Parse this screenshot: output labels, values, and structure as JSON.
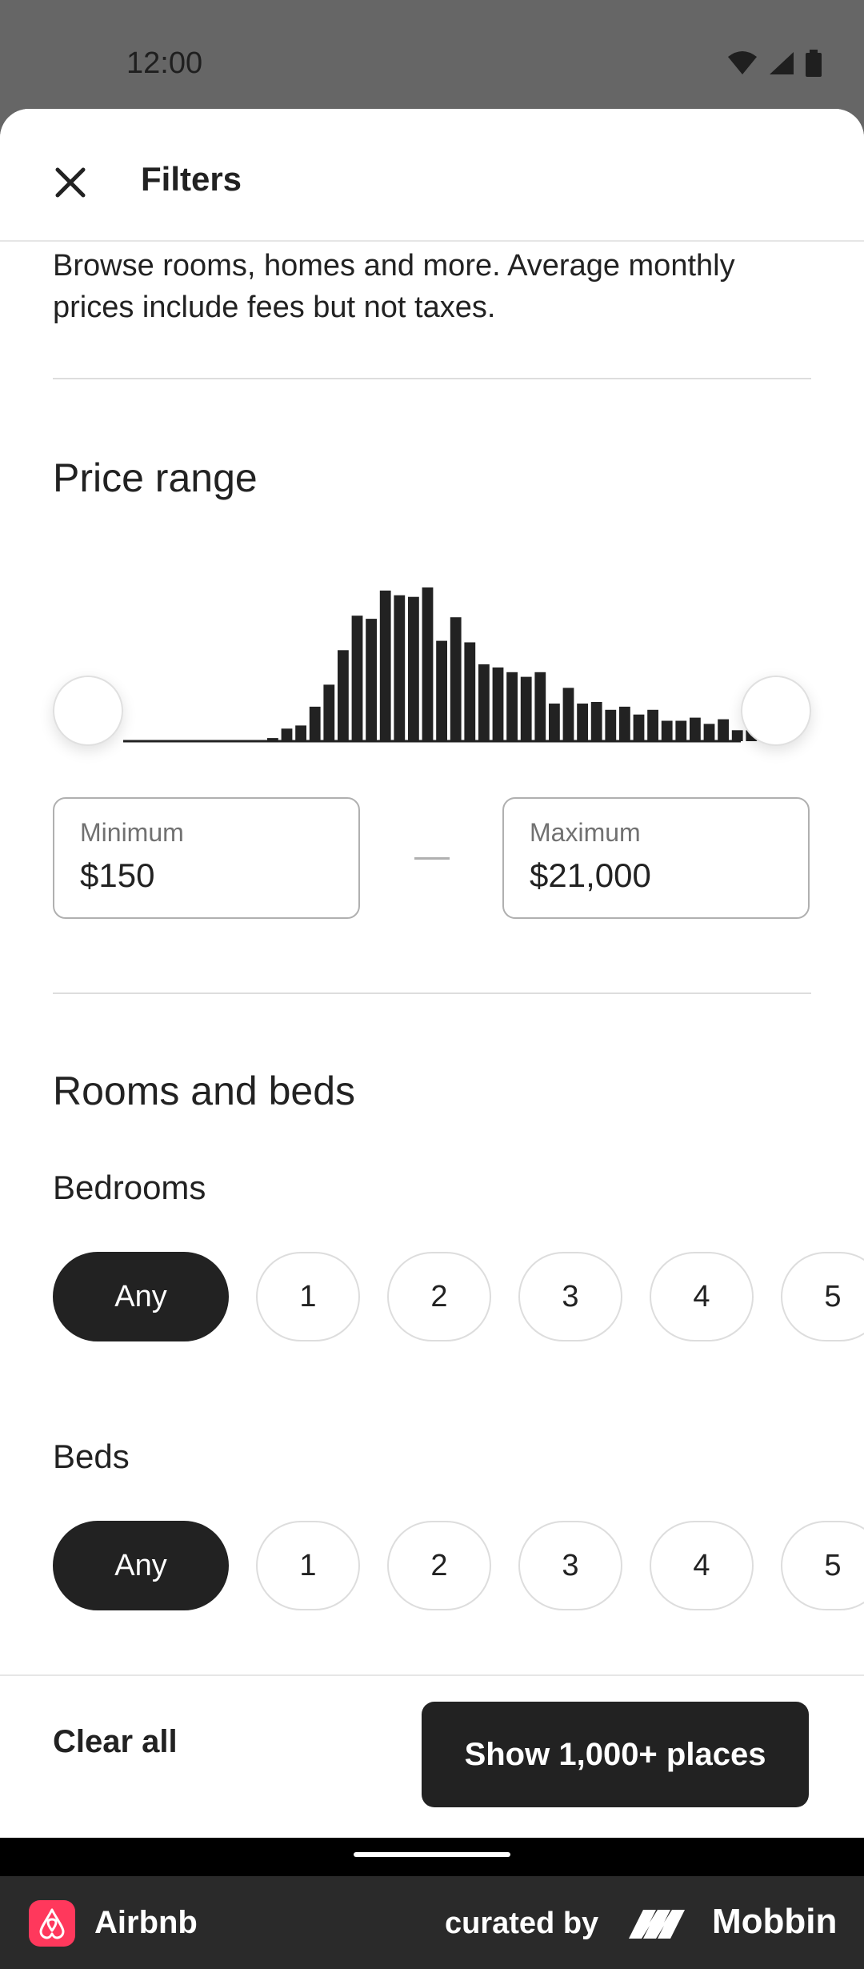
{
  "status_bar": {
    "time": "12:00"
  },
  "header": {
    "title": "Filters"
  },
  "intro_text": "Browse rooms, homes and more. Average monthly prices include fees but not taxes.",
  "price_range": {
    "title": "Price range",
    "minimum_label": "Minimum",
    "minimum_value": "$150",
    "maximum_label": "Maximum",
    "maximum_value": "$21,000",
    "histogram_levels": [
      0.02,
      0.08,
      0.1,
      0.22,
      0.36,
      0.58,
      0.8,
      0.78,
      0.96,
      0.93,
      0.92,
      0.98,
      0.64,
      0.79,
      0.63,
      0.49,
      0.47,
      0.44,
      0.41,
      0.44,
      0.24,
      0.34,
      0.24,
      0.25,
      0.2,
      0.22,
      0.17,
      0.2,
      0.13,
      0.13,
      0.15,
      0.11,
      0.14,
      0.07,
      0.07,
      0.04
    ]
  },
  "rooms_and_beds": {
    "title": "Rooms and beds",
    "bedrooms": {
      "label": "Bedrooms",
      "options": [
        "Any",
        "1",
        "2",
        "3",
        "4",
        "5"
      ],
      "selected": "Any"
    },
    "beds": {
      "label": "Beds",
      "options": [
        "Any",
        "1",
        "2",
        "3",
        "4",
        "5"
      ],
      "selected": "Any"
    }
  },
  "footer": {
    "clear_label": "Clear all",
    "show_label": "Show 1,000+ places"
  },
  "brand_bar": {
    "app_name": "Airbnb",
    "curated_by": "curated by",
    "mobbin": "Mobbin"
  },
  "colors": {
    "accent_dark": "#222222",
    "airbnb_brand": "#ff385c",
    "status_bar_bg": "#666666"
  },
  "icons": [
    "close-icon",
    "wifi-icon",
    "signal-icon",
    "battery-icon",
    "airbnb-logo-icon",
    "mobbin-logo-icon"
  ]
}
